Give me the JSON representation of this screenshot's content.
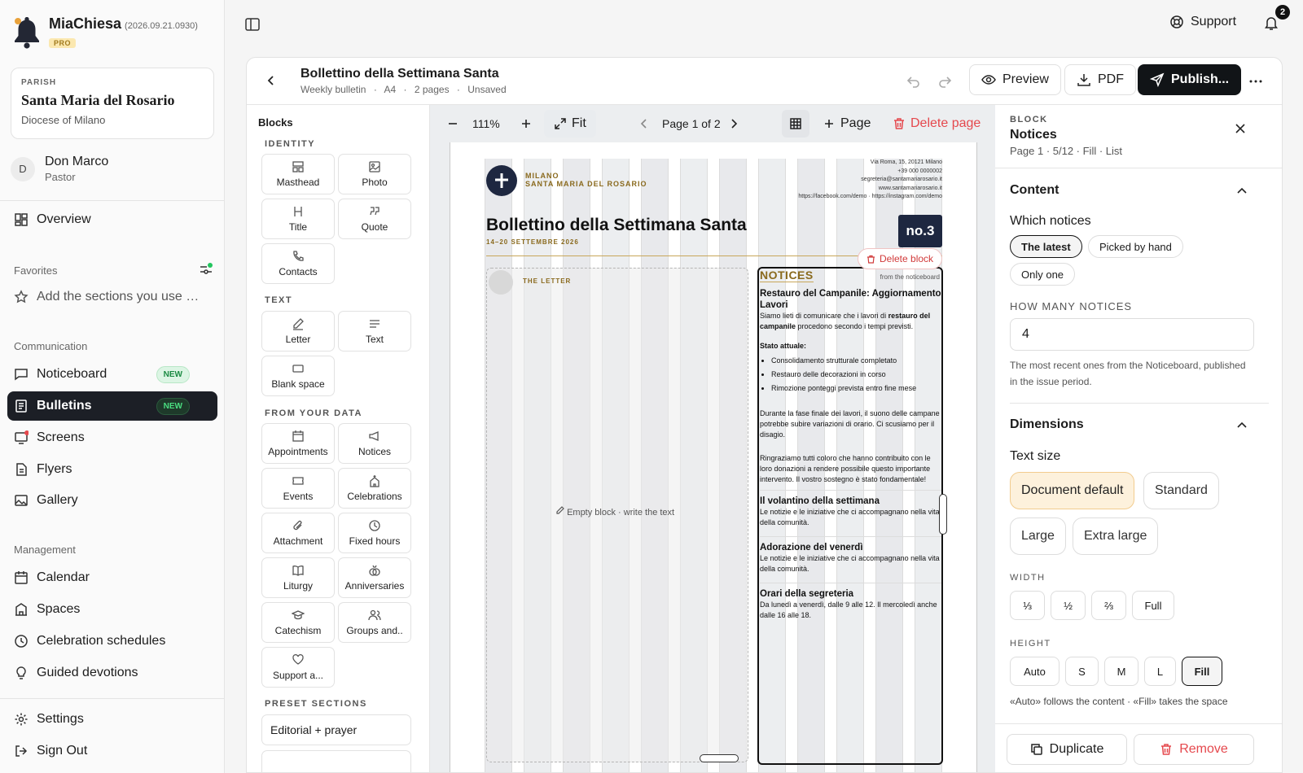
{
  "app": {
    "name": "MiaChiesa",
    "version": "(2026.09.21.0930)",
    "plan": "PRO"
  },
  "parish": {
    "caption": "PARISH",
    "name": "Santa Maria del Rosario",
    "diocese": "Diocese of Milano"
  },
  "user": {
    "initial": "D",
    "name": "Don Marco",
    "role": "Pastor"
  },
  "nav": {
    "overview": "Overview",
    "favorites_label": "Favorites",
    "favorites_add": "Add the sections you use most",
    "communication_label": "Communication",
    "noticeboard": "Noticeboard",
    "bulletins": "Bulletins",
    "new_badge": "NEW",
    "screens": "Screens",
    "flyers": "Flyers",
    "gallery": "Gallery",
    "management_label": "Management",
    "calendar": "Calendar",
    "spaces": "Spaces",
    "celebration_schedules": "Celebration schedules",
    "guided_devotions": "Guided devotions",
    "settings": "Settings",
    "sign_out": "Sign Out"
  },
  "topbar": {
    "support": "Support",
    "notifications_count": "2"
  },
  "doc": {
    "title": "Bollettino della Settimana Santa",
    "type": "Weekly bulletin",
    "format": "A4",
    "pages": "2 pages",
    "status": "Unsaved",
    "sep": "·"
  },
  "header_buttons": {
    "preview": "Preview",
    "pdf": "PDF",
    "publish": "Publish..."
  },
  "blocks_panel": {
    "title": "Blocks",
    "identity_label": "IDENTITY",
    "identity": [
      "Masthead",
      "Photo",
      "Title",
      "Quote",
      "Contacts"
    ],
    "text_label": "TEXT",
    "text": [
      "Letter",
      "Text",
      "Blank space"
    ],
    "data_label": "FROM YOUR DATA",
    "data": [
      "Appointments",
      "Notices",
      "Events",
      "Celebrations",
      "Attachment",
      "Fixed hours",
      "Liturgy",
      "Anniversaries",
      "Catechism",
      "Groups and..",
      "Support a..."
    ],
    "preset_label": "PRESET SECTIONS",
    "presets": [
      "Editorial + prayer"
    ]
  },
  "canvas_bar": {
    "zoom": "111%",
    "fit": "Fit",
    "page_indicator": "Page 1 of 2",
    "add_page": "Page",
    "delete_page": "Delete page"
  },
  "bulletin": {
    "city": "MILANO",
    "parish_caps": "SANTA MARIA DEL ROSARIO",
    "contacts": [
      "Via Roma, 15, 20121 Milano",
      "+39 000 0000002",
      "segreteria@santamariarosario.it",
      "www.santamariarosario.it",
      "https://facebook.com/demo · https://instagram.com/demo"
    ],
    "title": "Bollettino della Settimana Santa",
    "dates": "14–20 SETTEMBRE 2026",
    "issue": "no.3",
    "letter_caption": "THE LETTER",
    "empty_block": "Empty block · write the text",
    "delete_block": "Delete block",
    "notices_title": "NOTICES",
    "notices_from": "from the noticeboard",
    "notice1_title": "Restauro del Campanile: Aggiornamento Lavori",
    "notice1_p1a": "Siamo lieti di comunicare che i lavori di ",
    "notice1_p1b": "restauro del campanile",
    "notice1_p1c": " procedono secondo i tempi previsti.",
    "notice1_status": "Stato attuale:",
    "notice1_items": [
      "Consolidamento strutturale completato",
      "Restauro delle decorazioni in corso",
      "Rimozione ponteggi prevista entro fine mese"
    ],
    "notice1_p2": "Durante la fase finale dei lavori, il suono delle campane potrebbe subire variazioni di orario. Ci scusiamo per il disagio.",
    "notice1_p3": "Ringraziamo tutti coloro che hanno contribuito con le loro donazioni a rendere possibile questo importante intervento. Il vostro sostegno è stato fondamentale!",
    "notice2_title": "Il volantino della settimana",
    "notice2_text": "Le notizie e le iniziative che ci accompagnano nella vita della comunità.",
    "notice3_title": "Adorazione del venerdì",
    "notice3_text": "Le notizie e le iniziative che ci accompagnano nella vita della comunità.",
    "notice4_title": "Orari della segreteria",
    "notice4_text": "Da lunedì a venerdì, dalle 9 alle 12. Il mercoledì anche dalle 16 alle 18."
  },
  "props": {
    "caption": "BLOCK",
    "name": "Notices",
    "meta": "Page 1 · 5/12 · Fill · List",
    "content_section": "Content",
    "which_label": "Which notices",
    "which_options": [
      "The latest",
      "Picked by hand",
      "Only one"
    ],
    "how_many_label": "HOW MANY NOTICES",
    "how_many_value": "4",
    "how_many_hint": "The most recent ones from the Noticeboard, published in the issue period.",
    "dimensions_section": "Dimensions",
    "text_size_label": "Text size",
    "text_sizes": [
      "Document default",
      "Standard",
      "Large",
      "Extra large"
    ],
    "width_label": "WIDTH",
    "widths": [
      "⅓",
      "½",
      "⅔",
      "Full"
    ],
    "height_label": "HEIGHT",
    "heights": [
      "Auto",
      "S",
      "M",
      "L",
      "Fill"
    ],
    "height_hint": "«Auto» follows the content · «Fill» takes the space",
    "duplicate": "Duplicate",
    "remove": "Remove"
  },
  "colors": {
    "accent_dark": "#111417",
    "gold": "#8a6a1e",
    "danger": "#e5484d",
    "new_badge": "#1a8a42"
  }
}
